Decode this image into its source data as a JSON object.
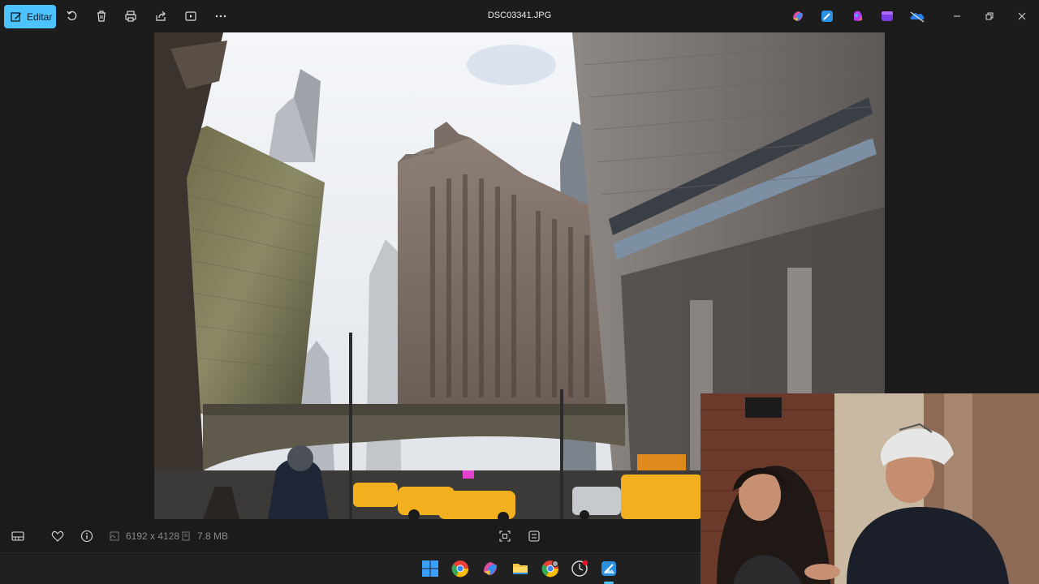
{
  "toolbar": {
    "edit_label": "Editar",
    "icons": [
      "edit-icon",
      "rotate-icon",
      "delete-icon",
      "print-icon",
      "share-icon",
      "slideshow-icon",
      "more-icon"
    ]
  },
  "window": {
    "title": "DSC03341.JPG",
    "controls": [
      "minimize-icon",
      "restore-icon",
      "close-icon"
    ]
  },
  "app_icons": [
    "copilot-icon",
    "photos-edit-icon",
    "designer-icon",
    "clipchamp-icon",
    "onedrive-icon"
  ],
  "infobar": {
    "dimensions": "6192 x 4128",
    "file_size": "7.8 MB",
    "icons": [
      "filmstrip-icon",
      "favorite-icon",
      "info-icon",
      "fit-icon",
      "actual-size-icon"
    ]
  },
  "taskbar": {
    "items": [
      "windows-start-icon",
      "chrome-icon",
      "copilot-icon",
      "file-explorer-icon",
      "chrome-profile-icon",
      "clock-app-icon",
      "photos-app-icon"
    ]
  },
  "colors": {
    "accent": "#4cc2ff",
    "background": "#1b1b1b",
    "taxi": "#f2b01e"
  }
}
